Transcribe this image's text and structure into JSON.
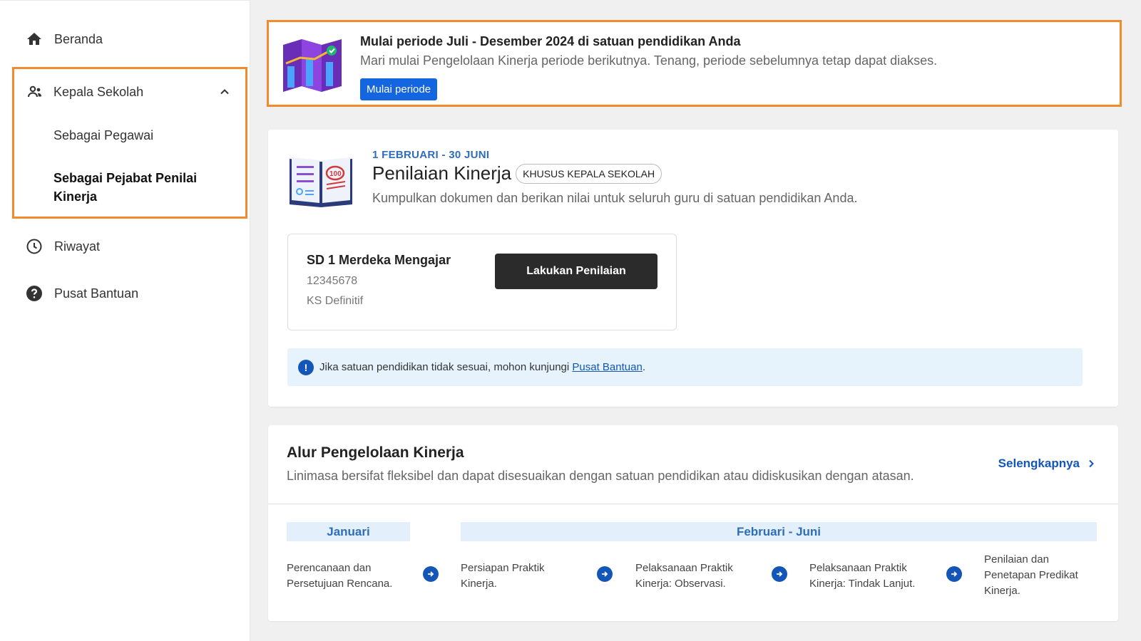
{
  "sidebar": {
    "home": {
      "label": "Beranda",
      "icon": "home-icon"
    },
    "group": {
      "label": "Kepala Sekolah",
      "icon": "people-icon",
      "expanded": true,
      "items": [
        {
          "label": "Sebagai Pegawai",
          "active": false
        },
        {
          "label": "Sebagai Pejabat Penilai Kinerja",
          "active": true
        }
      ]
    },
    "history": {
      "label": "Riwayat",
      "icon": "clock-icon"
    },
    "help": {
      "label": "Pusat Bantuan",
      "icon": "help-circle-icon"
    }
  },
  "banner": {
    "title": "Mulai periode Juli - Desember 2024 di satuan pendidikan Anda",
    "description": "Mari mulai Pengelolaan Kinerja periode berikutnya. Tenang, periode sebelumnya tetap dapat diakses.",
    "button": "Mulai periode"
  },
  "assessment": {
    "period": "1 FEBRUARI - 30 JUNI",
    "title": "Penilaian Kinerja",
    "badge": "KHUSUS KEPALA SEKOLAH",
    "description": "Kumpulkan dokumen dan berikan nilai untuk seluruh guru di satuan pendidikan Anda.",
    "school": {
      "name": "SD 1 Merdeka Mengajar",
      "npsn": "12345678",
      "status": "KS Definitif",
      "button": "Lakukan Penilaian"
    },
    "info": {
      "text": "Jika satuan pendidikan tidak sesuai, mohon kunjungi ",
      "link": "Pusat Bantuan",
      "suffix": "."
    }
  },
  "flow": {
    "title": "Alur Pengelolaan Kinerja",
    "description": "Linimasa bersifat fleksibel dan dapat disesuaikan dengan satuan pendidikan atau didiskusikan dengan atasan.",
    "more": "Selengkapnya",
    "months": [
      "Januari",
      "Februari - Juni"
    ],
    "steps": [
      "Perencanaan dan Persetujuan Rencana.",
      "Persiapan Praktik Kinerja.",
      "Pelaksanaan Praktik Kinerja: Observasi.",
      "Pelaksanaan Praktik Kinerja: Tindak Lanjut.",
      "Penilaian dan Penetapan Predikat Kinerja."
    ]
  },
  "colors": {
    "accent_blue": "#1365e0",
    "highlight_orange": "#f08c2b",
    "link_blue": "#1456b8"
  }
}
